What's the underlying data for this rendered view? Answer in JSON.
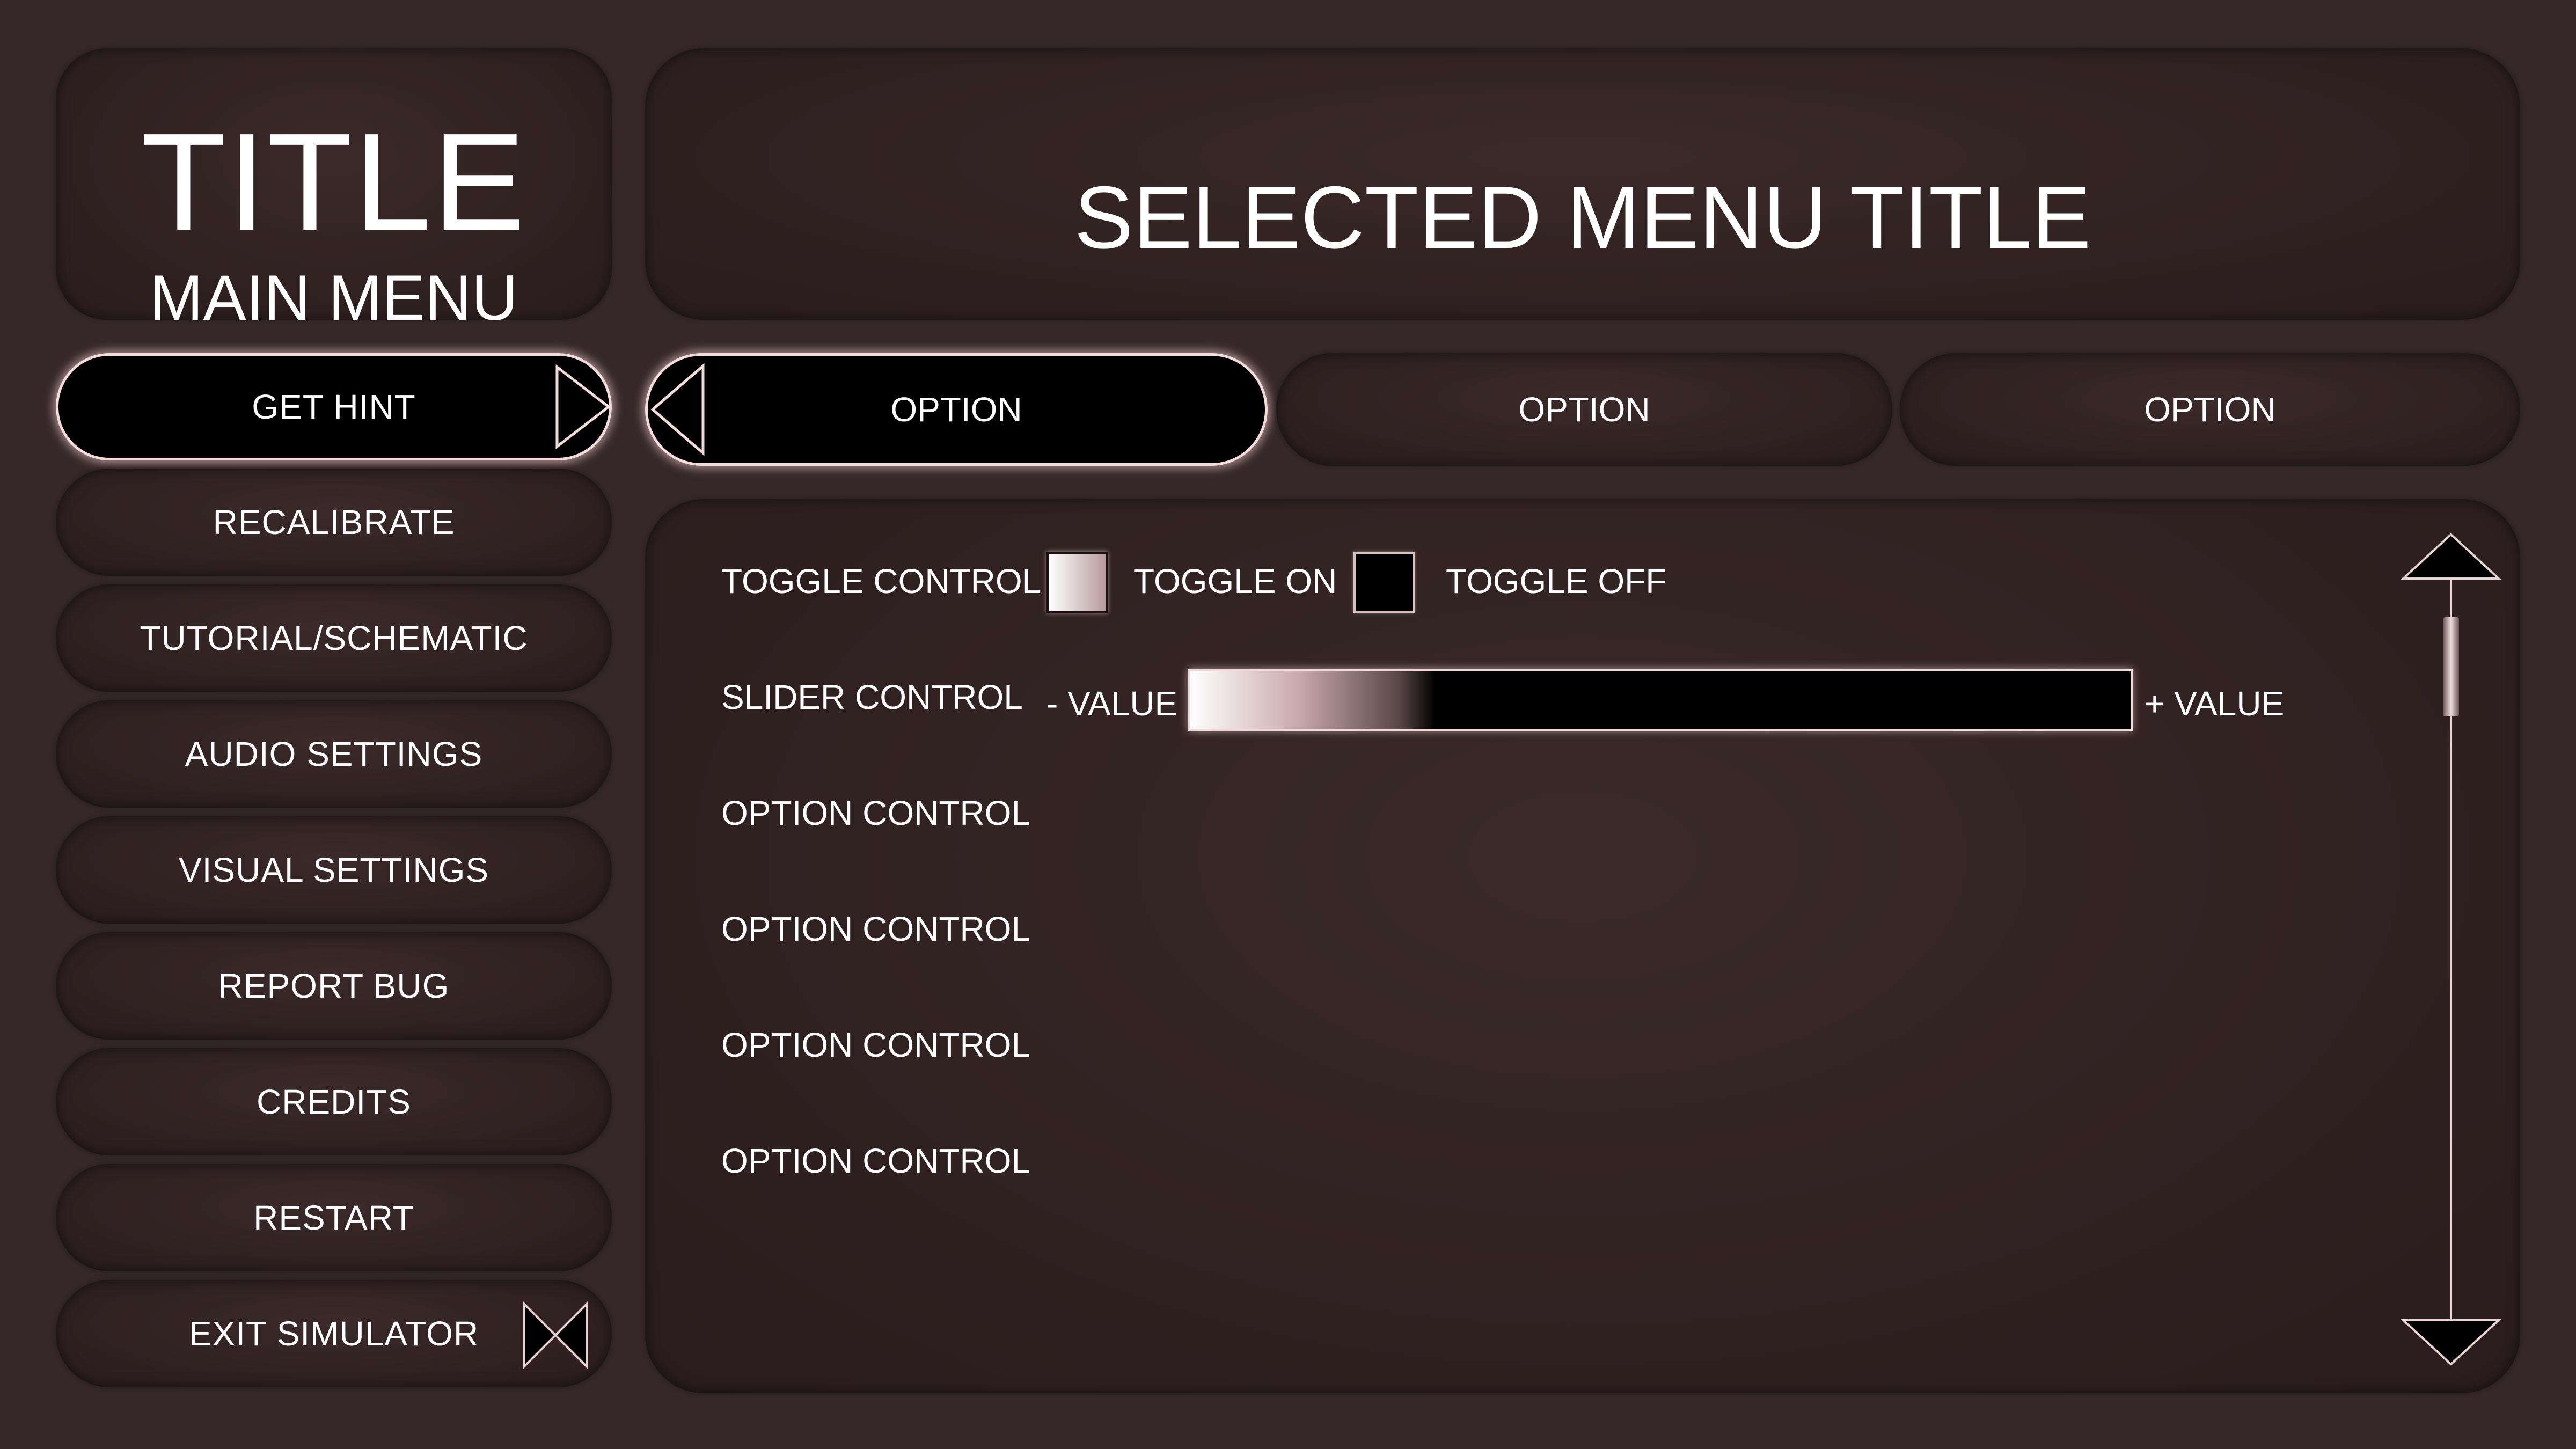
{
  "app": {
    "title": "TITLE",
    "subtitle": "MAIN MENU"
  },
  "header": {
    "selected_title": "SELECTED MENU TITLE"
  },
  "sidebar": {
    "items": [
      {
        "label": "GET HINT",
        "icon": "chevron-right-icon"
      },
      {
        "label": "RECALIBRATE"
      },
      {
        "label": "TUTORIAL/SCHEMATIC"
      },
      {
        "label": "AUDIO SETTINGS"
      },
      {
        "label": "VISUAL SETTINGS"
      },
      {
        "label": "REPORT BUG"
      },
      {
        "label": "CREDITS"
      },
      {
        "label": "RESTART"
      },
      {
        "label": "EXIT SIMULATOR",
        "icon": "close-bowtie-icon"
      }
    ]
  },
  "tabs": [
    {
      "label": "OPTION",
      "active": true,
      "icon": "chevron-left-icon"
    },
    {
      "label": "OPTION"
    },
    {
      "label": "OPTION"
    }
  ],
  "content": {
    "rows": [
      {
        "label": "TOGGLE CONTROL"
      },
      {
        "label": "SLIDER CONTROL"
      },
      {
        "label": "OPTION CONTROL"
      },
      {
        "label": "OPTION CONTROL"
      },
      {
        "label": "OPTION CONTROL"
      },
      {
        "label": "OPTION CONTROL"
      }
    ],
    "toggle": {
      "on_label": "TOGGLE ON",
      "off_label": "TOGGLE OFF"
    },
    "slider": {
      "min_label": "- VALUE",
      "max_label": "+ VALUE",
      "value": 0.26
    }
  },
  "colors": {
    "background": "#362828",
    "panel": "#2e2020",
    "active": "#000000",
    "glow": "#f4dcdc"
  }
}
